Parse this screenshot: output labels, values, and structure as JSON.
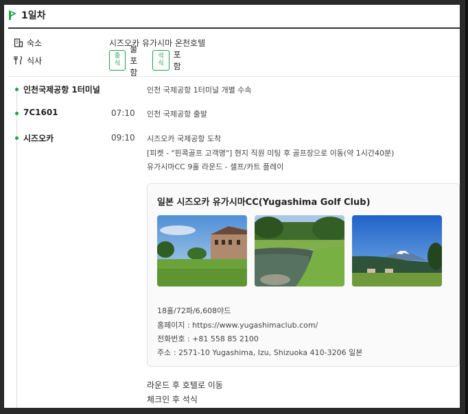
{
  "day": {
    "title": "1일차"
  },
  "info": {
    "lodging_label": "숙소",
    "lodging_value": "시즈오카 유가시마 온천호텔",
    "meal_label": "식사",
    "meals": [
      {
        "tag": "중식",
        "value": "불포함"
      },
      {
        "tag": "석식",
        "value": "포함"
      }
    ]
  },
  "steps": [
    {
      "place": "인천국제공항 1터미널",
      "time": "",
      "lines": [
        "인천 국제공항 1터미널 개별 수속"
      ]
    },
    {
      "place": "7C1601",
      "time": "07:10",
      "lines": [
        "인천 국제공항 출발"
      ]
    },
    {
      "place": "시즈오카",
      "time": "09:10",
      "lines": [
        "시즈오카 국제공항 도착",
        "[피켓 - \"핀콕골프 고객명\"] 현지 직원 미팅 후 골프장으로 이동(약 1시간40분)",
        "유가시마CC 9홀 라운드 - 셀프/카트 플레이"
      ]
    }
  ],
  "card": {
    "title": "일본 시즈오카 유가시마CC(Yugashima Golf Club)",
    "photos": [
      "clubhouse-photo",
      "pond-photo",
      "mount-fuji-photo"
    ],
    "lines": [
      "18홀/72파/6,608야드",
      "홈페이지 : https://www.yugashimaclub.com/",
      "전화번호 : +81 558 85 2100",
      "주소 : 2571-10 Yugashima, Izu, Shizuoka 410-3206 일본"
    ]
  },
  "after": [
    "라운드 후 호텔로 이동",
    "체크인 후 석식"
  ],
  "colors": {
    "accent": "#1aa34a",
    "text": "#222222",
    "border": "#e2e2e2"
  }
}
